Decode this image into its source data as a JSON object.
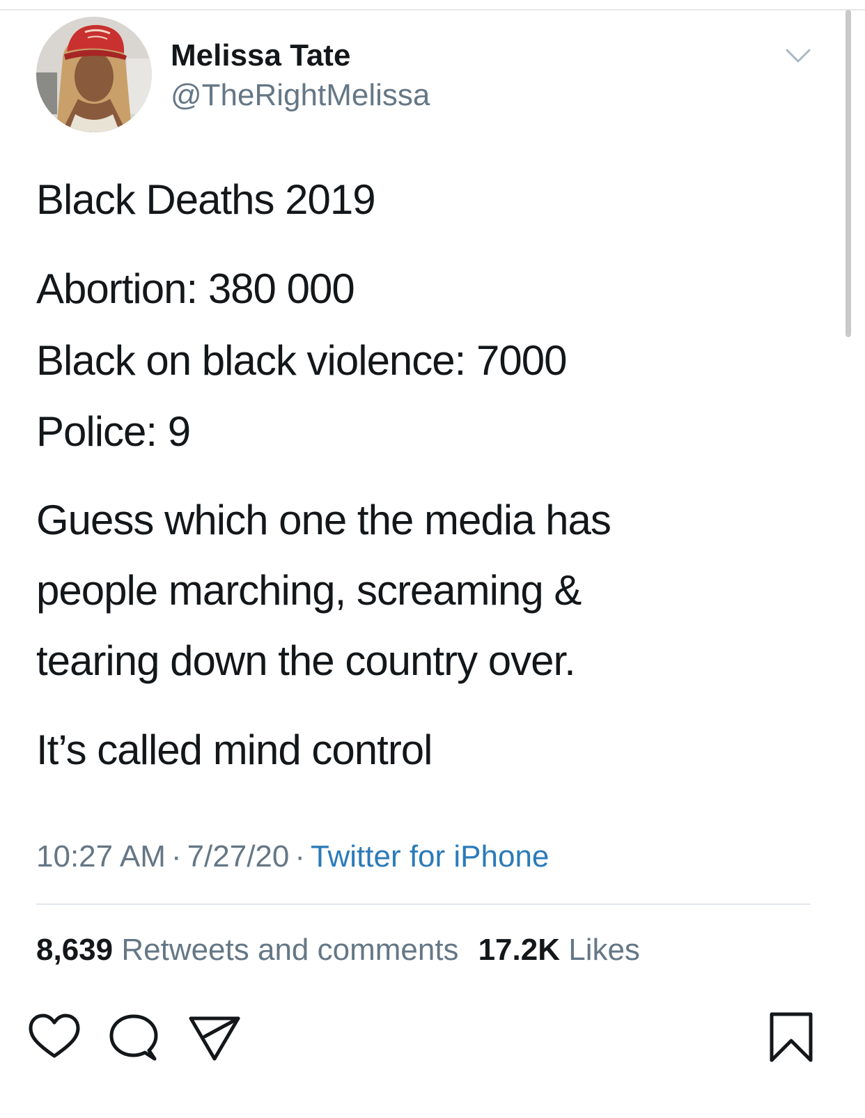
{
  "tweet": {
    "author": {
      "display_name": "Melissa Tate",
      "handle": "@TheRightMelissa"
    },
    "body_lines": [
      "Black Deaths 2019",
      "Abortion: 380 000",
      "Black on black violence: 7000",
      "Police: 9",
      "Guess which one the media has",
      "people marching, screaming &",
      "tearing down the country over.",
      "It’s called mind control"
    ],
    "meta": {
      "time": "10:27 AM",
      "separator": "·",
      "date": "7/27/20",
      "source": "Twitter for iPhone"
    },
    "stats": {
      "retweets_count": "8,639",
      "retweets_label": "Retweets and comments",
      "likes_count": "17.2K",
      "likes_label": "Likes"
    },
    "actions": {
      "like_icon": "heart-icon",
      "reply_icon": "speech-bubble-icon",
      "share_icon": "paper-plane-icon",
      "bookmark_icon": "bookmark-icon"
    }
  },
  "colors": {
    "text_primary": "#14171a",
    "text_secondary": "#657786",
    "link": "#2b7bb9",
    "divider": "#e1e8ed"
  }
}
